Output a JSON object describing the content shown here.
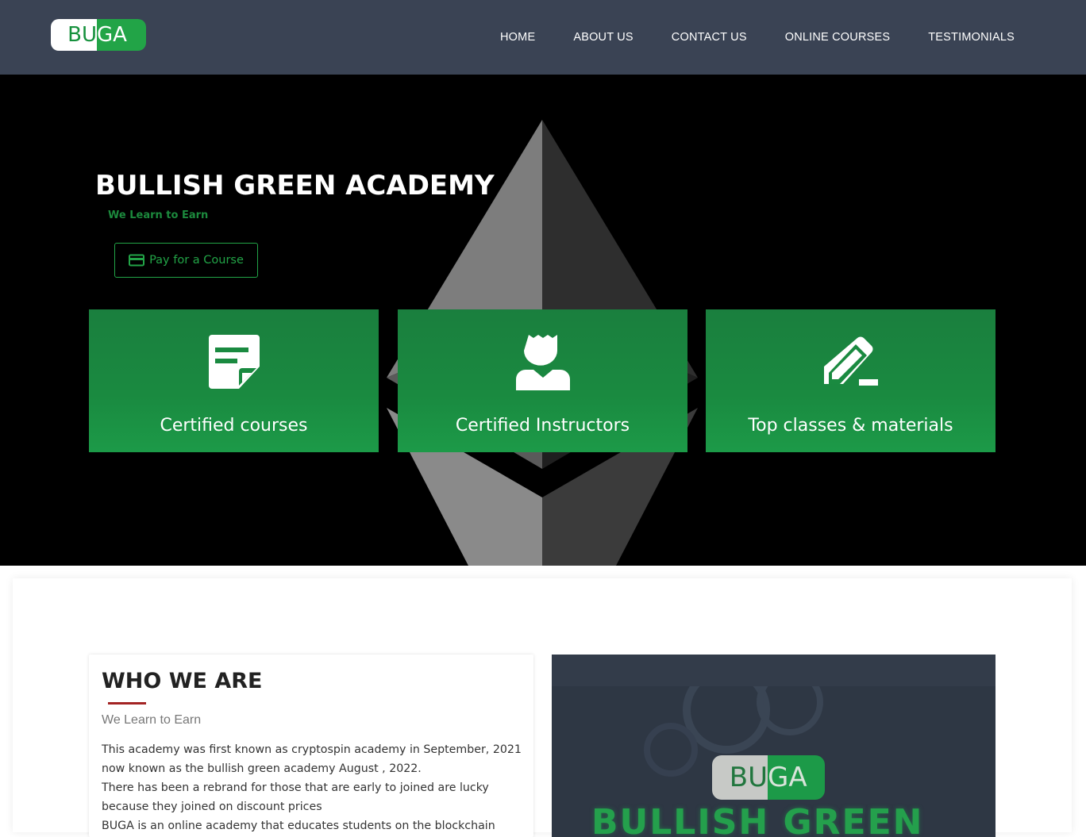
{
  "brand": {
    "logo_left": "BU",
    "logo_right": "GA"
  },
  "nav": {
    "items": [
      "HOME",
      "ABOUT US",
      "CONTACT US",
      "ONLINE COURSES",
      "TESTIMONIALS"
    ]
  },
  "hero": {
    "title": "BULLISH GREEN ACADEMY",
    "tagline": "We Learn to Earn",
    "pay_button": "Pay for a Course",
    "features": [
      {
        "label": "Certified courses",
        "icon": "note-icon"
      },
      {
        "label": "Certified Instructors",
        "icon": "instructor-icon"
      },
      {
        "label": "Top classes & materials",
        "icon": "pencil-icon"
      }
    ]
  },
  "about": {
    "title": "WHO WE ARE",
    "subtitle": "We Learn to Earn",
    "paragraph_1": "This academy was first known as cryptospin academy in September, 2021 now known as the bullish green academy August , 2022.",
    "paragraph_2": "There has been a rebrand for those that are early to joined are lucky because they joined on discount prices",
    "paragraph_3": "BUGA is an online academy that educates students on the blockchain",
    "image_logo_left": "BU",
    "image_logo_right": "GA",
    "image_text": "BULLISH GREEN"
  },
  "colors": {
    "navbar": "#3a4354",
    "accent_green": "#22a447",
    "feature_green": "#1a8a40",
    "underline_red": "#a32323"
  }
}
